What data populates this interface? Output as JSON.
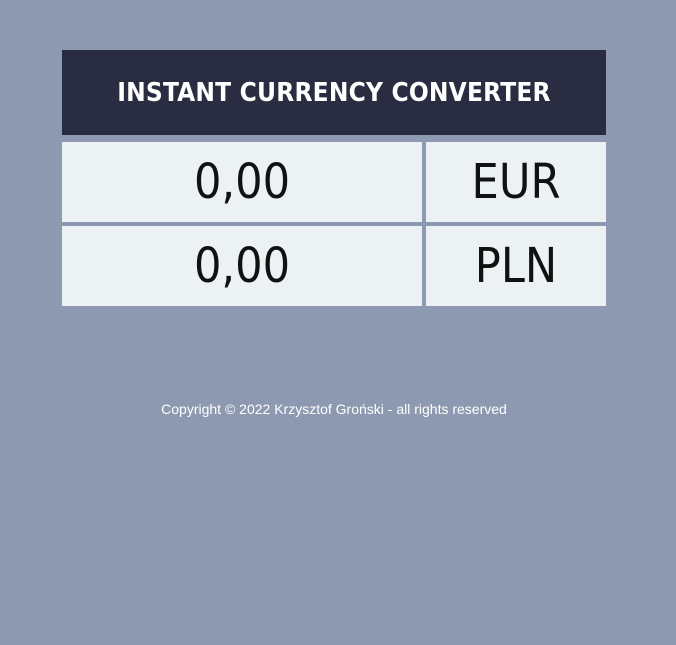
{
  "header": {
    "title": "INSTANT CURRENCY CONVERTER"
  },
  "rows": [
    {
      "amount": "0,00",
      "currency": "EUR"
    },
    {
      "amount": "0,00",
      "currency": "PLN"
    }
  ],
  "footer": {
    "copyright": "Copyright © 2022 Krzysztof Groński - all rights reserved"
  },
  "colors": {
    "background": "#8c99b0",
    "header_bg": "#2a2d42",
    "field_bg": "#ecf1f4"
  }
}
